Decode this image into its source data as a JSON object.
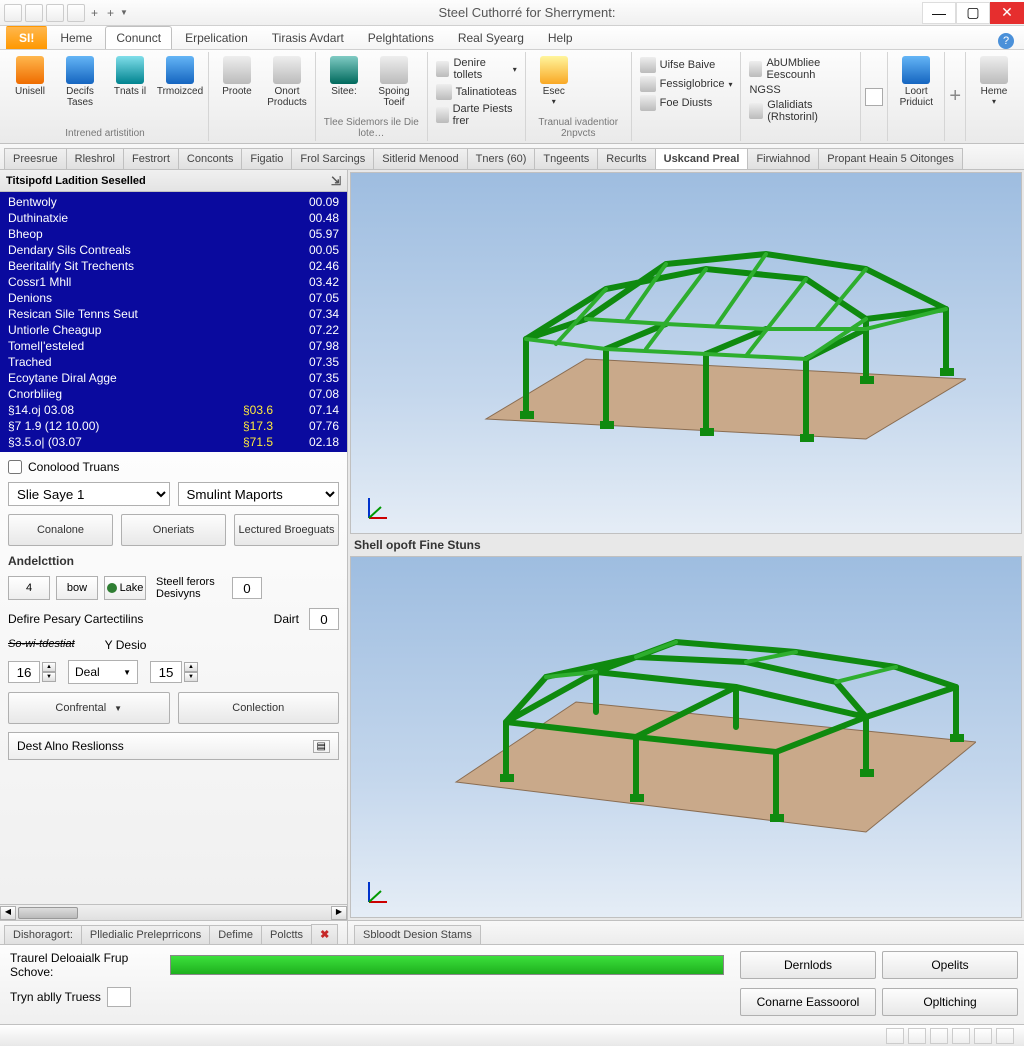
{
  "window": {
    "title": "Steel Cuthorré for Sherryment:"
  },
  "ribbon": {
    "file": "SI!",
    "tabs": [
      "Heme",
      "Conunct",
      "Erpelication",
      "Tirasis Avdart",
      "Pelghtations",
      "Real Syearg",
      "Help"
    ],
    "active": 1,
    "groups": {
      "g1": {
        "items": [
          {
            "label": "Unisell",
            "sub": ""
          },
          {
            "label": "Decifs",
            "sub": "Tases"
          },
          {
            "label": "Tnats il",
            "sub": ""
          },
          {
            "label": "Trmoizced",
            "sub": ""
          }
        ],
        "caption": "Intrened artistition"
      },
      "g2": {
        "items": [
          {
            "label": "Proote"
          },
          {
            "label": "Onort",
            "sub": "Products"
          }
        ]
      },
      "g3": {
        "items": [
          {
            "label": "Sitee:"
          },
          {
            "label": "Spoing",
            "sub": "Toeif"
          }
        ],
        "caption": "Tlee Sidemors ile Die lote…"
      },
      "g4": {
        "rows": [
          "Denire tollets",
          "Talinatioteas",
          "Darte Piests frer"
        ]
      },
      "g5": {
        "items": [
          {
            "label": "Esec"
          }
        ],
        "caption": "Tranual ivadentior 2npvcts"
      },
      "g6": {
        "rows": [
          "Uifse Baive",
          "Fessiglobrice",
          "Foe Diusts"
        ]
      },
      "g7": {
        "rows": [
          "AbUMbliee Eescounh",
          "NGSS",
          "Glalidiats (Rhstorinl)"
        ]
      },
      "g8": {
        "items": [
          {
            "label": "Loort",
            "sub": "Priduict"
          }
        ]
      },
      "g9": {
        "items": [
          {
            "label": "Heme"
          }
        ]
      }
    }
  },
  "doc_tabs": {
    "items": [
      "Preesrue",
      "Rleshrol",
      "Festrort",
      "Conconts",
      "Figatio",
      "Frol Sarcings",
      "Sitlerid Menood",
      "Tners (60)",
      "Tngeents",
      "Recurlts",
      "Uskcand Preal",
      "Firwiahnod",
      "Propant Heain 5 Oitonges"
    ],
    "active": 10
  },
  "left": {
    "title": "Titsipofd Ladition Seselled",
    "rows": [
      {
        "lbl": "Bentwoly",
        "v2": "00.09"
      },
      {
        "lbl": "Duthinatxie",
        "v2": "00.48"
      },
      {
        "lbl": "Bheop",
        "v2": "05.97"
      },
      {
        "lbl": "Dendary Sils Contreals",
        "v2": "00.05"
      },
      {
        "lbl": "Beeritalify Sit Trechents",
        "v2": "02.46"
      },
      {
        "lbl": "Cossr1 Mhll",
        "v2": "03.42"
      },
      {
        "lbl": "Denions",
        "v2": "07.05"
      },
      {
        "lbl": "Resican Sile Tenns Seut",
        "v2": "07.34"
      },
      {
        "lbl": "Untiorle Cheagup",
        "v2": "07.22"
      },
      {
        "lbl": "Tomel|'esteled",
        "v2": "07.98"
      },
      {
        "lbl": "Trached",
        "v2": "07.35"
      },
      {
        "lbl": "Ecoytane Diral Agge",
        "v2": "07.35"
      },
      {
        "lbl": "Cnorbliieg",
        "v2": "07.08"
      },
      {
        "lbl": "§14.oj 03.08",
        "v1": "§03.6",
        "v2": "07.14"
      },
      {
        "lbl": "§7 1.9 (12  10.00)",
        "v1": "§17.3",
        "v2": "07.76"
      },
      {
        "lbl": "§3.5.o| (03.07",
        "v1": "§71.5",
        "v2": "02.18"
      }
    ],
    "checkbox": "Conolood Truans",
    "sel1": "Slie Saye 1",
    "sel2": "Smulint Maports",
    "btn1": "Conalone",
    "btn2": "Oneriats",
    "btn3": "Lectured Broeguats",
    "section": "Andelcttion",
    "mini": {
      "a": "4",
      "b": "bow",
      "c": "Lake"
    },
    "steel_label": "Steell ferors Desivyns",
    "steel_val": "0",
    "define_label": "Defire Pesary Cartectilins",
    "dart_label": "Dairt",
    "dart_val": "0",
    "sdlabel": "So-wi-tdestiat",
    "ydlabel": "Y Desio",
    "spin1": "16",
    "sel_deal": "Deal",
    "spin2": "15",
    "btn4": "Confrental",
    "btn5": "Conlection",
    "dest": "Dest Alno Reslionss"
  },
  "bottom_tabs_left": [
    "Dishoragort:",
    "Plledialic Preleprricons",
    "Defime",
    "Polctts"
  ],
  "caption_mid": "Shell opoft Fine Stuns",
  "bottom_tabs_right": "Sbloodt Desion Stams",
  "status": {
    "progress_label": "Traurel Deloaialk Frup Schove:",
    "try_label": "Tryn ablly Truess",
    "try_val": "",
    "btns": [
      "Dernlods",
      "Opelits",
      "Conarne Eassoorol",
      "Opltiching"
    ]
  }
}
